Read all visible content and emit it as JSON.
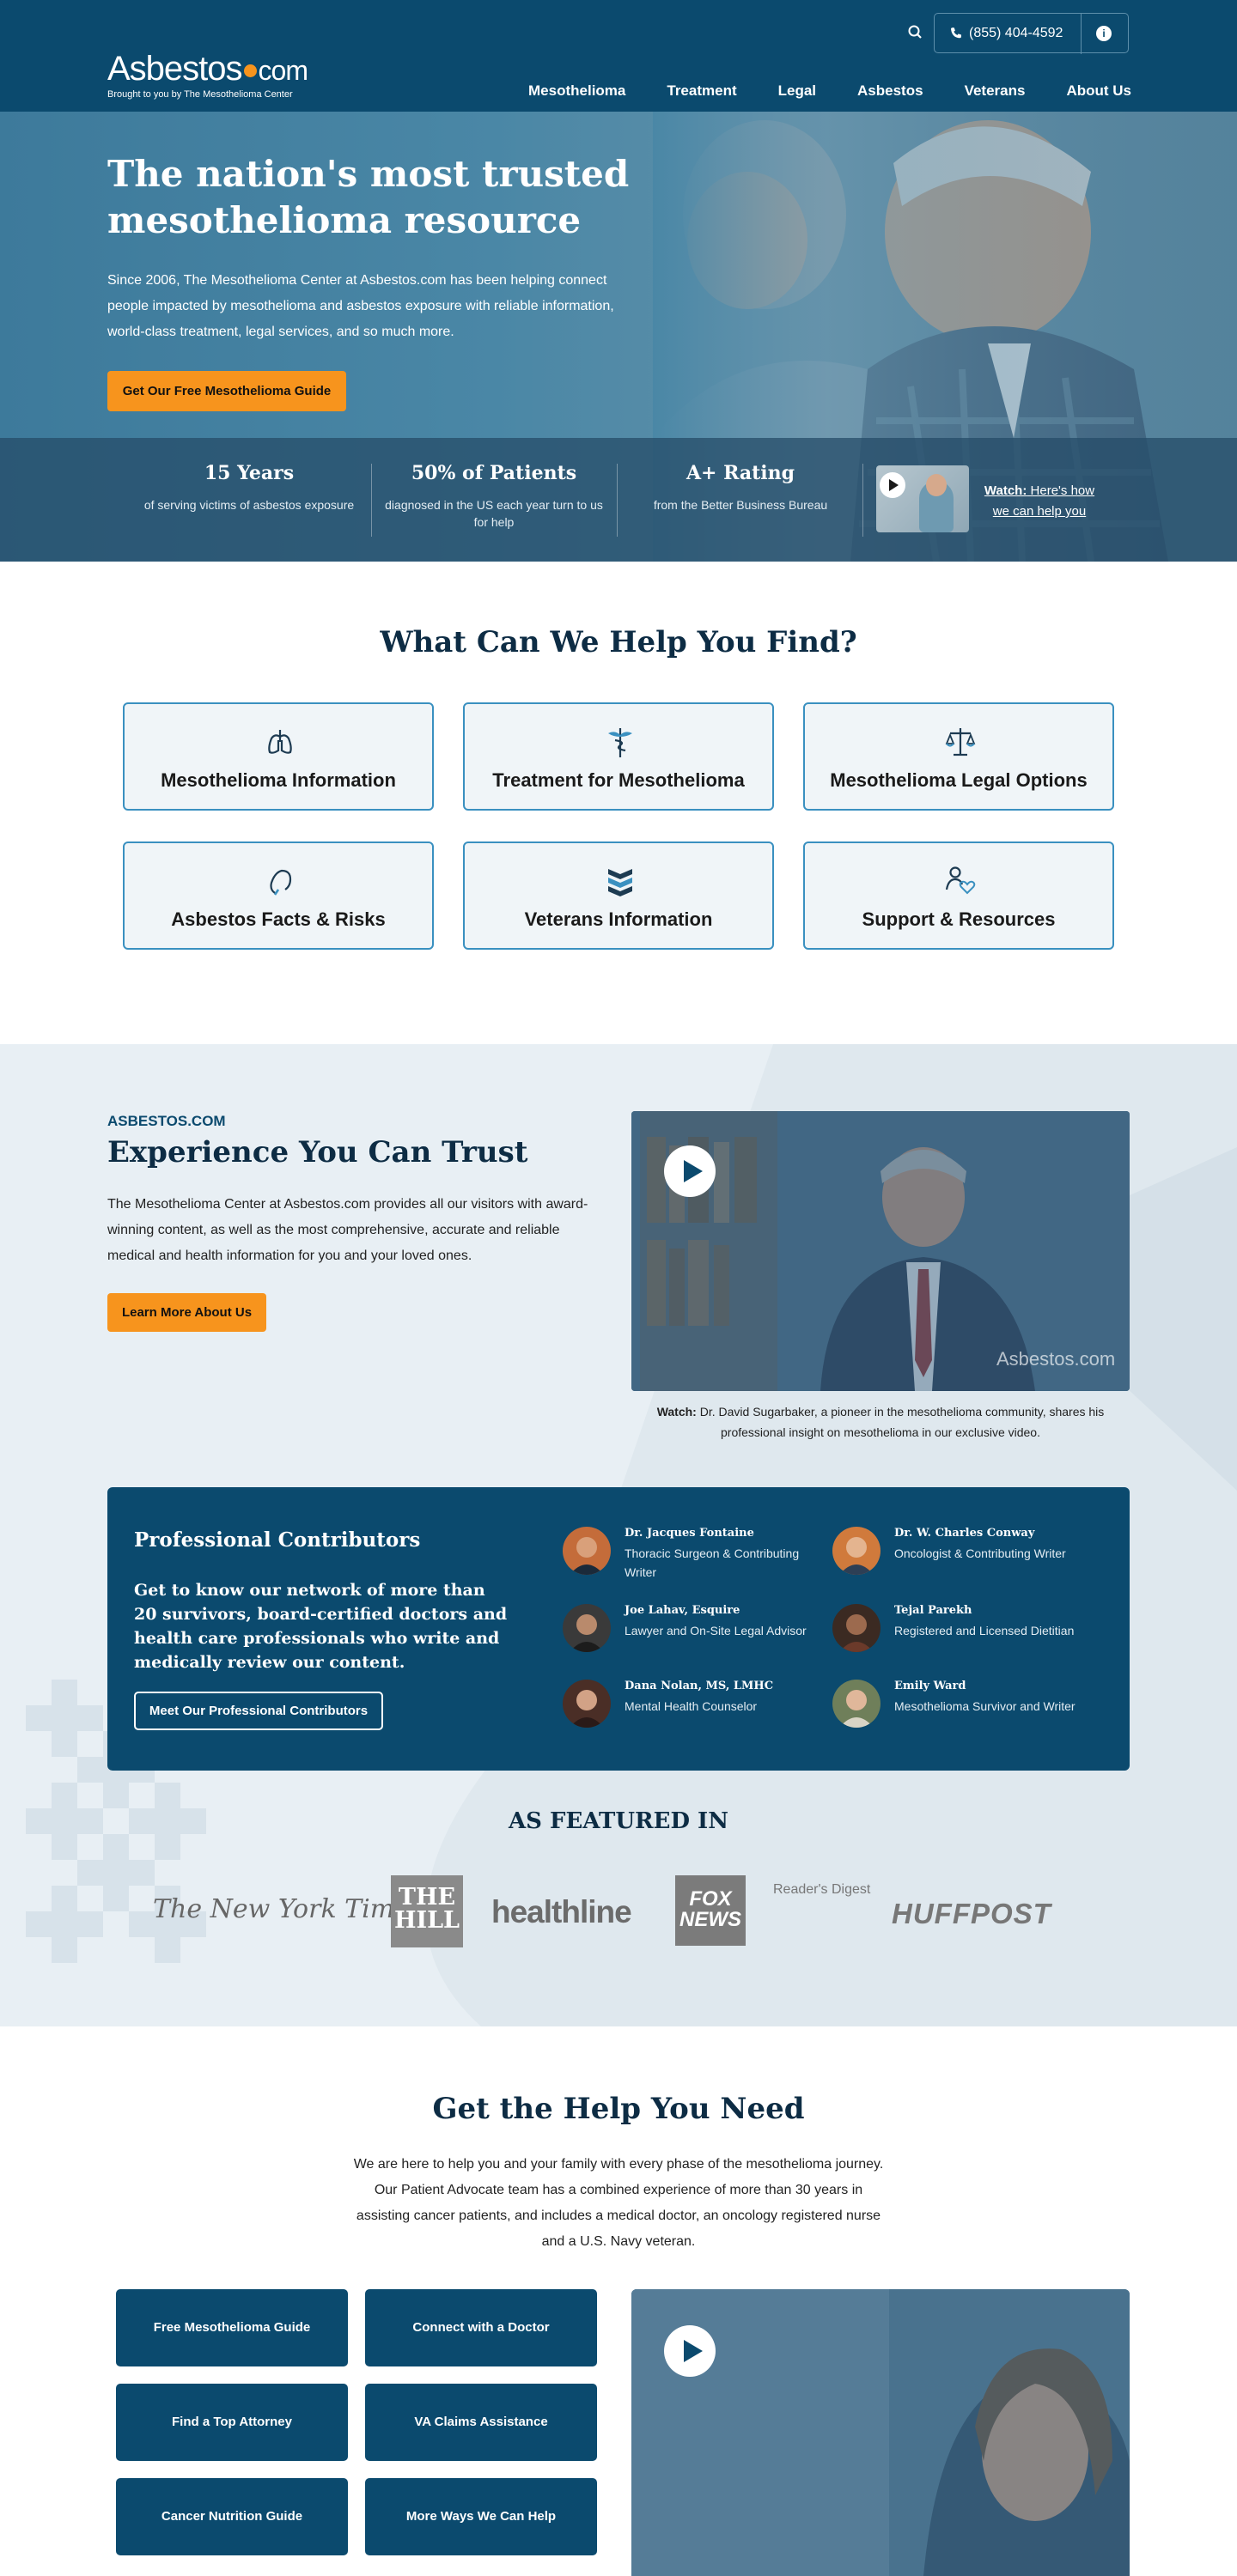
{
  "header": {
    "logo_main": "Asbestos",
    "logo_com": "com",
    "logo_tagline": "Brought to you by The Mesothelioma Center",
    "phone": "(855) 404-4592",
    "info_icon": "i",
    "nav": [
      "Mesothelioma",
      "Treatment",
      "Legal",
      "Asbestos",
      "Veterans",
      "About Us"
    ]
  },
  "hero": {
    "title": "The nation's most trusted mesothelioma resource",
    "text": "Since 2006, The Mesothelioma Center at Asbestos.com has been helping connect people impacted by mesothelioma and asbestos exposure with reliable information, world-class treatment, legal services, and so much more.",
    "cta": "Get Our Free Mesothelioma Guide",
    "stats": [
      {
        "value": "15 Years",
        "desc": "of serving victims of asbestos exposure"
      },
      {
        "value": "50% of Patients",
        "desc": "diagnosed in the US each year turn to us for help"
      },
      {
        "value": "A+ Rating",
        "desc": "from the Better Business Bureau"
      }
    ],
    "watch_label": "Watch:",
    "watch_text": "Here's how we can help you"
  },
  "find": {
    "title": "What Can We Help You Find?",
    "cards": [
      {
        "label": "Mesothelioma Information",
        "icon": "lungs-icon"
      },
      {
        "label": "Treatment for Mesothelioma",
        "icon": "caduceus-icon"
      },
      {
        "label": "Mesothelioma Legal Options",
        "icon": "scales-icon"
      },
      {
        "label": "Asbestos Facts & Risks",
        "icon": "hook-icon"
      },
      {
        "label": "Veterans Information",
        "icon": "chevron-rank-icon"
      },
      {
        "label": "Support & Resources",
        "icon": "person-heart-icon"
      }
    ]
  },
  "experience": {
    "eyebrow": "ASBESTOS.COM",
    "title": "Experience You Can Trust",
    "text": "The Mesothelioma Center at Asbestos.com provides all our visitors with award-winning content, as well as the most comprehensive, accurate and reliable medical and health information for you and your loved ones.",
    "cta": "Learn More About Us",
    "video_watermark": "Asbestos.com",
    "caption_label": "Watch:",
    "caption": "Dr. David Sugarbaker, a pioneer in the mesothelioma community, shares his professional insight on mesothelioma in our exclusive video."
  },
  "contributors": {
    "title": "Professional Contributors",
    "desc": "Get to know our network of more than 20 survivors, board-certified doctors and health care professionals who write and medically review our content.",
    "button": "Meet Our Professional Contributors",
    "people": [
      {
        "name": "Dr. Jacques Fontaine",
        "role": "Thoracic Surgeon & Contributing Writer"
      },
      {
        "name": "Dr. W. Charles Conway",
        "role": "Oncologist & Contributing Writer"
      },
      {
        "name": "Joe Lahav, Esquire",
        "role": "Lawyer and On-Site Legal Advisor"
      },
      {
        "name": "Tejal Parekh",
        "role": "Registered and Licensed Dietitian"
      },
      {
        "name": "Dana Nolan, MS, LMHC",
        "role": "Mental Health Counselor"
      },
      {
        "name": "Emily Ward",
        "role": "Mesothelioma Survivor and Writer"
      }
    ]
  },
  "featured": {
    "title": "AS FEATURED IN",
    "logos": [
      "The New York Times",
      "THE HILL",
      "healthline",
      "FOX NEWS",
      "Reader's Digest",
      "HUFFPOST"
    ]
  },
  "help": {
    "title": "Get the Help You Need",
    "text": "We are here to help you and your family with every phase of the mesothelioma journey. Our Patient Advocate team has a combined experience of more than 30 years in assisting cancer patients, and includes a medical doctor, an oncology registered nurse and a U.S. Navy veteran.",
    "buttons": [
      "Free Mesothelioma Guide",
      "Connect with a Doctor",
      "Find a Top Attorney",
      "VA Claims Assistance",
      "Cancer Nutrition Guide",
      "More Ways We Can Help"
    ]
  },
  "colors": {
    "primary": "#0b4a6e",
    "accent": "#f7941d",
    "card_border": "#3a90c0",
    "section_bg": "#e8eff4"
  }
}
